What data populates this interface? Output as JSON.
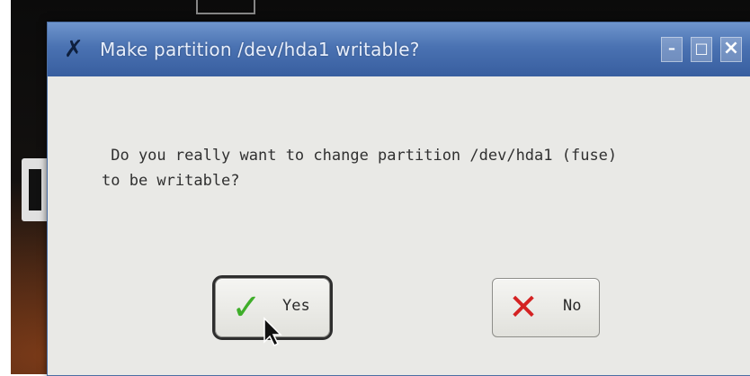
{
  "dialog": {
    "title": "Make partition /dev/hda1 writable?",
    "message_line1": " Do you really want to change partition /dev/hda1 (fuse)",
    "message_line2": "to be writable?",
    "window_controls": {
      "minimize_glyph": "–",
      "maximize_glyph": "□",
      "close_glyph": "×"
    },
    "buttons": {
      "yes_label": "Yes",
      "yes_icon": "checkmark-icon",
      "no_label": "No",
      "no_icon": "x-mark-icon"
    },
    "focused_button": "yes"
  },
  "colors": {
    "titlebar": "#4a72b2",
    "dialog_bg": "#e9e9e6",
    "check": "#3fae2a",
    "cross": "#d42222"
  }
}
